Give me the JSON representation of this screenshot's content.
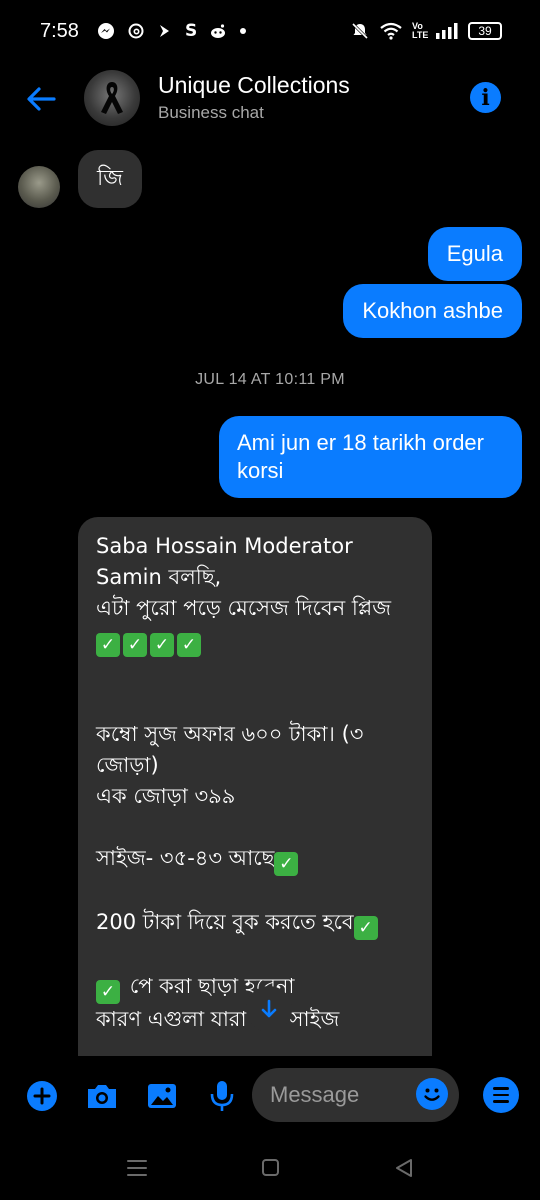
{
  "status_bar": {
    "time": "7:58",
    "left_icons": [
      "messenger-icon",
      "threads-icon",
      "arrow-icon",
      "s-icon",
      "reddit-icon",
      "dot-icon"
    ],
    "battery": "39",
    "volte": "Vo LTE"
  },
  "header": {
    "title": "Unique Collections",
    "subtitle": "Business chat"
  },
  "messages": [
    {
      "side": "in",
      "text": "জি"
    },
    {
      "side": "out",
      "text": "Egula"
    },
    {
      "side": "out",
      "text": "Kokhon ashbe"
    },
    {
      "side": "out",
      "text": "Ami jun er 18 tarikh order korsi"
    }
  ],
  "timestamp": "JUL 14 AT 10:11 PM",
  "long_message": {
    "line1": "Saba Hossain Moderator Samin বলছি,",
    "line2": "এটা পুরো পড়ে মেসেজ দিবেন প্লিজ",
    "line3": "কম্বো সুজ অফার ৬০০ টাকা। (৩ জোড়া)",
    "line4": "এক জোড়া ৩৯৯",
    "line5": "সাইজ- ৩৫-৪৩ আছে",
    "line6": "200 টাকা দিয়ে বুক করতে হবে",
    "line7": "পে করা ছাড়া হবেনা",
    "line8": "কারণ এগুলা যারা যার সাইজ"
  },
  "composer": {
    "placeholder": "Message"
  },
  "colors": {
    "accent": "#0a7cff",
    "incoming_bubble": "#303030",
    "background": "#000000"
  }
}
